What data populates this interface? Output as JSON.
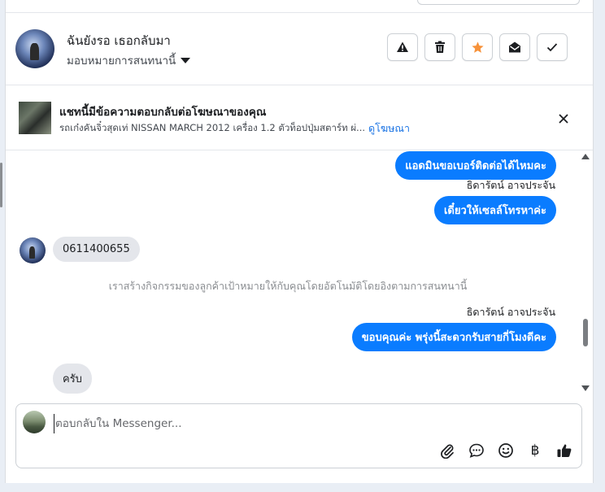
{
  "header": {
    "contact_name": "ฉันยังรอ เธอกลับมา",
    "assign_label": "มอบหมายการสนทนานี้",
    "actions": [
      {
        "name": "spam-button",
        "icon": "warning-icon"
      },
      {
        "name": "delete-button",
        "icon": "trash-icon"
      },
      {
        "name": "star-button",
        "icon": "star-icon",
        "color": "#f7923a"
      },
      {
        "name": "mark-unread-button",
        "icon": "envelope-open-icon"
      },
      {
        "name": "mark-done-button",
        "icon": "check-icon"
      }
    ]
  },
  "ad": {
    "title": "แชทนี้มีข้อความตอบกลับต่อโฆษณาของคุณ",
    "description": "รถเก๋งคันจิ๋วสุดเท่ NISSAN MARCH 2012 เครื่อง 1.2 ตัวท็อปปุ่มสตาร์ท ผ่...",
    "link_label": "ดูโฆษณา"
  },
  "messages": {
    "out_1": "แอดมินขอเบอร์ติดต่อได้ไหมคะ",
    "sender_1": "ธิดารัตน์ อาจประจัน",
    "out_2": "เดี๋ยวให้เซลล์โทรหาค่ะ",
    "in_1": "0611400655",
    "system_note": "เราสร้างกิจกรรมของลูกค้าเป้าหมายให้กับคุณโดยอัตโนมัติโดยอิงตามการสนทนานี้",
    "sender_2": "ธิดารัตน์ อาจประจัน",
    "out_3": "ขอบคุณค่ะ พรุ่งนี้สะดวกรับสายกี่โมงดีคะ",
    "in_2": "ครับ"
  },
  "composer": {
    "placeholder": "ตอบกลับใน Messenger...",
    "tools": [
      "paperclip-icon",
      "speech-bubble-icon",
      "emoji-icon",
      "baht-icon",
      "thumbs-up-icon"
    ],
    "baht_symbol": "฿"
  },
  "colors": {
    "outgoing_bubble": "#0a7cff",
    "incoming_bubble": "#e4e6eb",
    "link": "#1b74e4",
    "star": "#f7923a"
  }
}
